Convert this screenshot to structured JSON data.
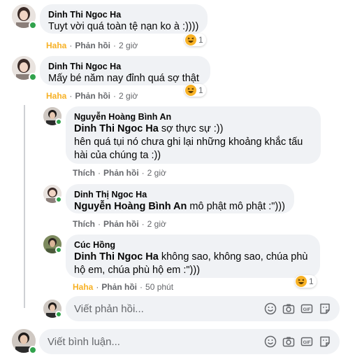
{
  "comments": [
    {
      "author": "Dinh Thi Ngoc Ha",
      "text": "Tuyt vời quá toàn tệ nạn ko à :))))",
      "actions": {
        "like": "Haha",
        "reply": "Phản hồi",
        "time": "2 giờ"
      },
      "reaction": {
        "icon": "haha-emoji",
        "count": "1"
      }
    },
    {
      "author": "Dinh Thi Ngoc Ha",
      "text": "Mấy bé năm nay đỉnh quá sợ thật",
      "actions": {
        "like": "Haha",
        "reply": "Phản hồi",
        "time": "2 giờ"
      },
      "reaction": {
        "icon": "haha-emoji",
        "count": "1"
      }
    }
  ],
  "replies": [
    {
      "author": "Nguyễn Hoàng Bình An",
      "mention": "Dinh Thi Ngoc Ha",
      "text_line1": " sợ thực sự :))",
      "text_line2": "hên quá tụi nó chưa ghi lại những khoảng khắc tấu",
      "text_line3": "hài của chúng ta :))",
      "actions": {
        "like": "Thích",
        "reply": "Phản hồi",
        "time": "2 giờ"
      }
    },
    {
      "author": "Dinh Thị Ngoc Ha",
      "mention": "Nguyễn Hoàng Bình An",
      "text_line1": " mô phật mô phật :\")))",
      "actions": {
        "like": "Thích",
        "reply": "Phản hồi",
        "time": "2 giờ"
      }
    },
    {
      "author": "Cúc Hồng",
      "mention": "Dinh Thi Ngoc Ha",
      "text_line1": " không sao, không sao, chúa phù",
      "text_line2": "hộ em, chúa phù hộ em :\")))",
      "actions": {
        "like": "Haha",
        "reply": "Phản hồi",
        "time": "50 phút"
      },
      "reaction": {
        "icon": "haha-emoji",
        "count": "1"
      }
    }
  ],
  "reply_box": {
    "placeholder": "Viết phản hồi..."
  },
  "comment_box": {
    "placeholder": "Viết bình luận..."
  },
  "toolbar_icons": [
    "emoji-icon",
    "camera-icon",
    "gif-icon",
    "sticker-icon"
  ],
  "colors": {
    "haha": "#f7b125",
    "online": "#31a24c",
    "bubble": "#f0f2f5",
    "meta": "#65676b"
  }
}
